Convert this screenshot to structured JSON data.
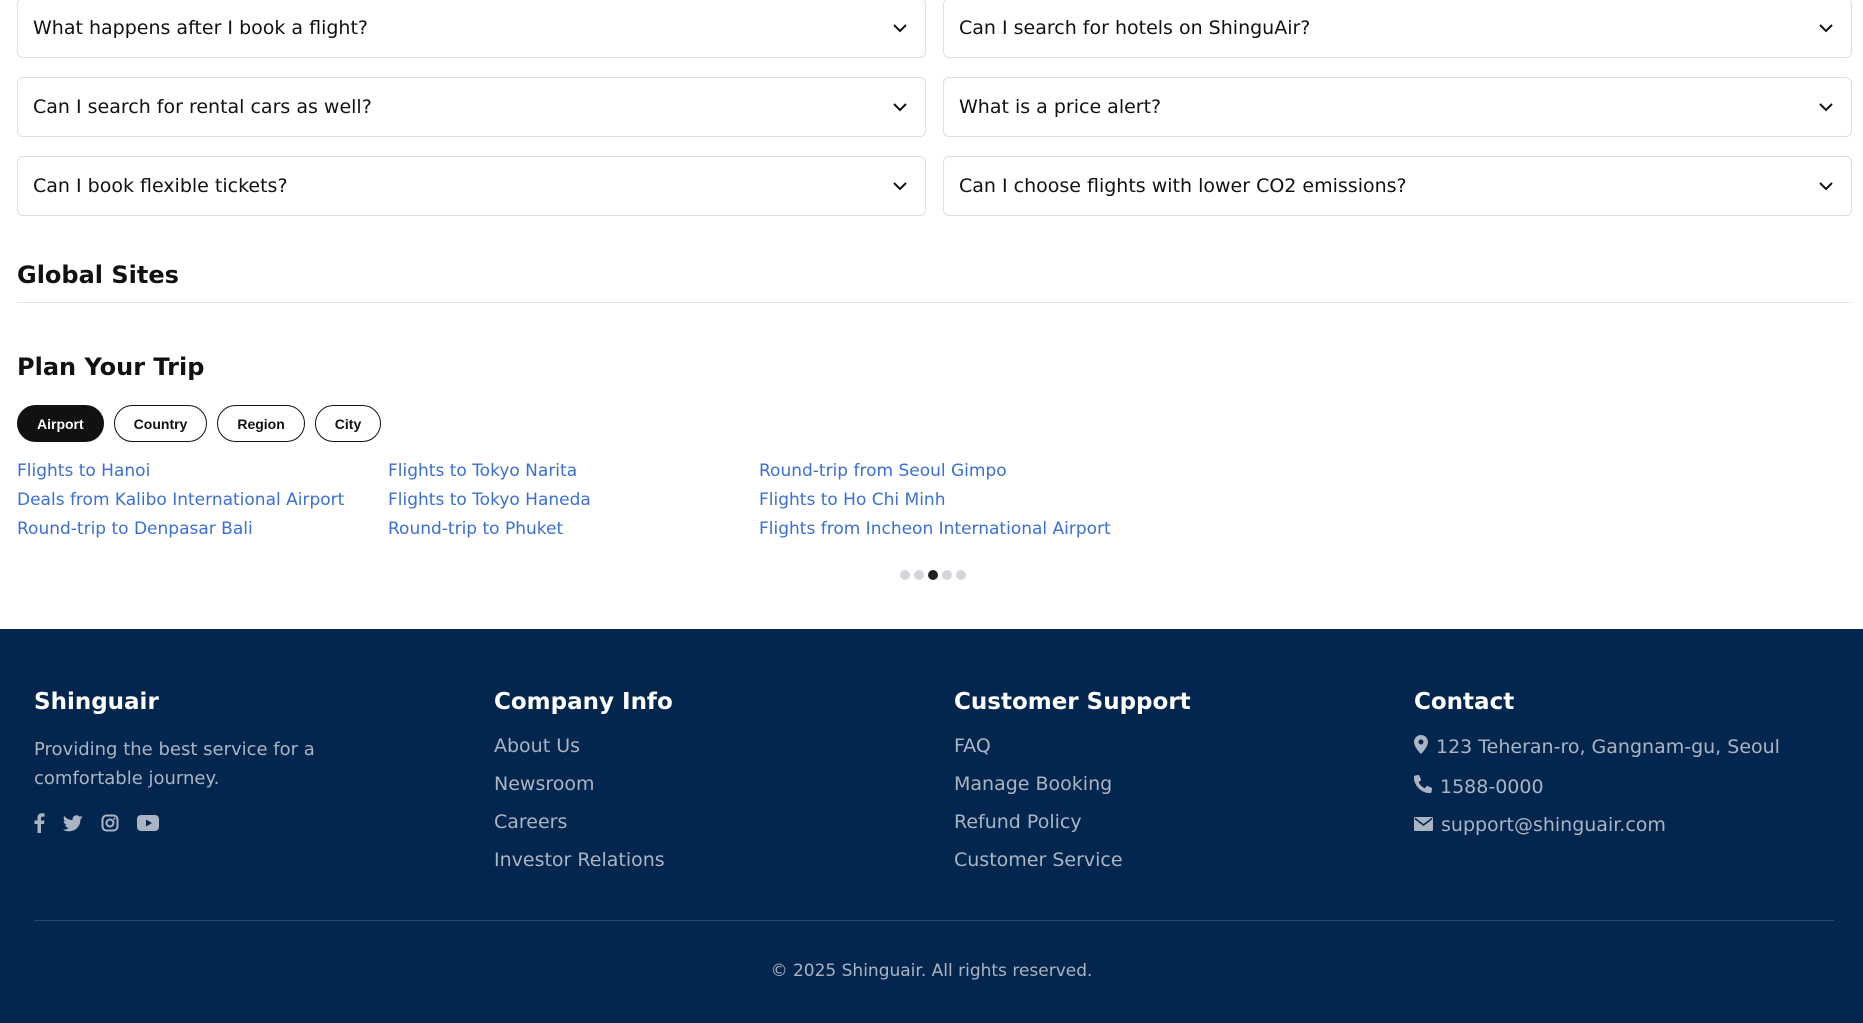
{
  "faq": {
    "items": [
      {
        "question": "What happens after I book a flight?"
      },
      {
        "question": "Can I search for hotels on ShinguAir?"
      },
      {
        "question": "Can I search for rental cars as well?"
      },
      {
        "question": "What is a price alert?"
      },
      {
        "question": "Can I book flexible tickets?"
      },
      {
        "question": "Can I choose flights with lower CO2 emissions?"
      }
    ]
  },
  "global_sites": {
    "title": "Global Sites"
  },
  "plan_trip": {
    "title": "Plan Your Trip",
    "tabs": [
      {
        "label": "Airport",
        "active": true
      },
      {
        "label": "Country",
        "active": false
      },
      {
        "label": "Region",
        "active": false
      },
      {
        "label": "City",
        "active": false
      }
    ],
    "columns": [
      [
        "Flights to Hanoi",
        "Deals from Kalibo International Airport",
        "Round-trip to Denpasar Bali"
      ],
      [
        "Flights to Tokyo Narita",
        "Flights to Tokyo Haneda",
        "Round-trip to Phuket"
      ],
      [
        "Round-trip from Seoul Gimpo",
        "Flights to Ho Chi Minh",
        "Flights from Incheon International Airport"
      ]
    ],
    "pagination": {
      "total": 5,
      "active_index": 2
    }
  },
  "footer": {
    "brand": {
      "name": "Shinguair",
      "description": "Providing the best service for a comfortable journey.",
      "social_icons": [
        "facebook-icon",
        "twitter-icon",
        "instagram-icon",
        "youtube-icon"
      ]
    },
    "company": {
      "title": "Company Info",
      "links": [
        "About Us",
        "Newsroom",
        "Careers",
        "Investor Relations"
      ]
    },
    "support": {
      "title": "Customer Support",
      "links": [
        "FAQ",
        "Manage Booking",
        "Refund Policy",
        "Customer Service"
      ]
    },
    "contact": {
      "title": "Contact",
      "address": "123 Teheran-ro, Gangnam-gu, Seoul",
      "phone": "1588-0000",
      "email": "support@shinguair.com"
    },
    "copyright": "© 2025 Shinguair. All rights reserved."
  },
  "colors": {
    "link_blue": "#3b6fd4",
    "footer_bg": "#03264f",
    "pill_active": "#111111"
  }
}
